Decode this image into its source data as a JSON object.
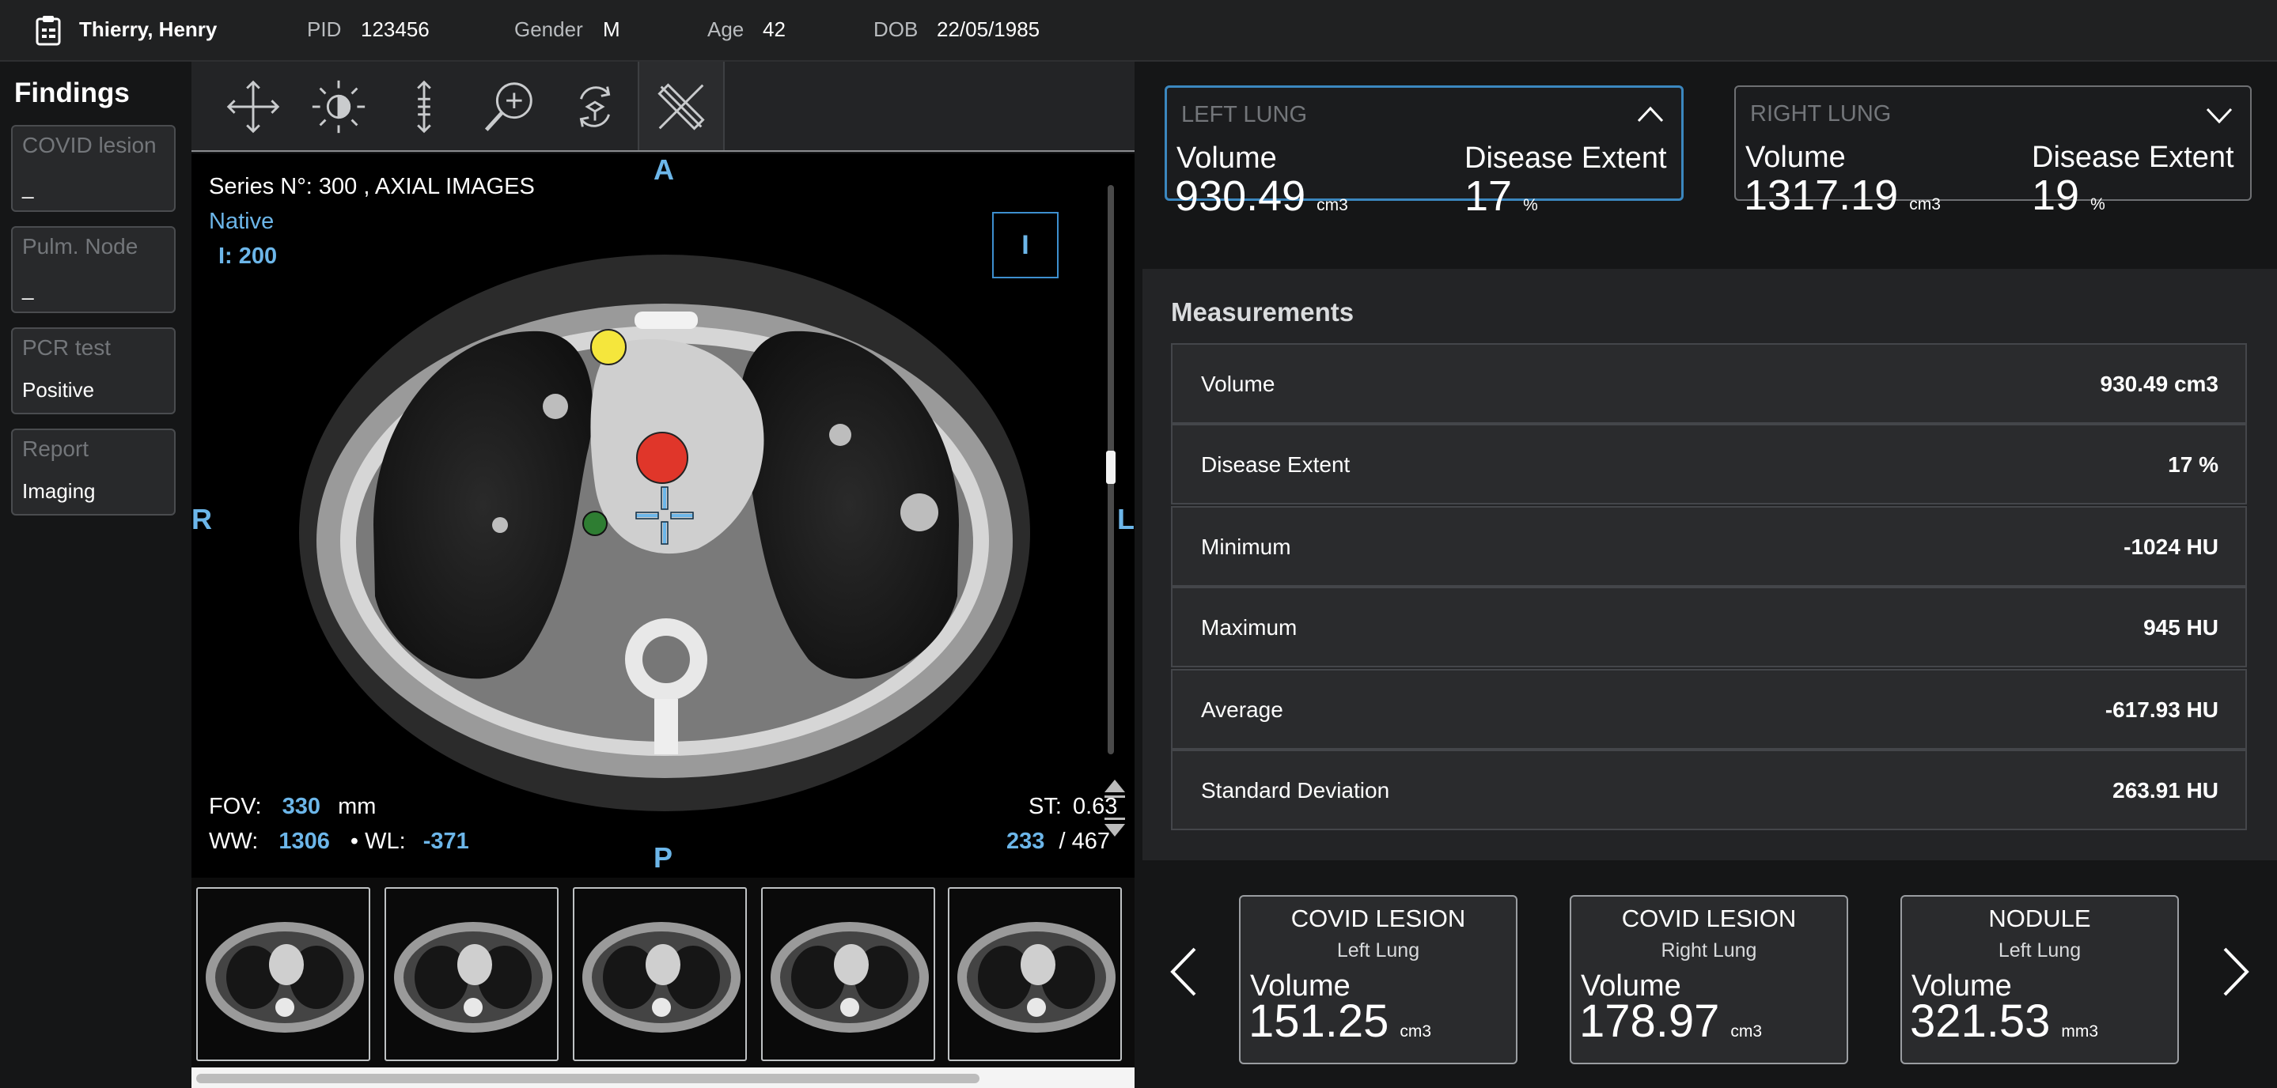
{
  "patient": {
    "name": "Thierry, Henry",
    "pid_label": "PID",
    "pid": "123456",
    "gender_label": "Gender",
    "gender": "M",
    "age_label": "Age",
    "age": "42",
    "dob_label": "DOB",
    "dob": "22/05/1985"
  },
  "findings": {
    "title": "Findings",
    "items": [
      {
        "label": "COVID lesion",
        "value": "_"
      },
      {
        "label": "Pulm. Node",
        "value": "_"
      },
      {
        "label": "PCR test",
        "value": "Positive"
      },
      {
        "label": "Report",
        "value": "Imaging"
      }
    ]
  },
  "toolbar": {
    "tools": [
      "move-icon",
      "brightness-icon",
      "scroll-slices-icon",
      "zoom-icon",
      "rotate-3d-icon",
      "measure-ruler-icon"
    ]
  },
  "viewer": {
    "series": "Series N°: 300 , AXIAL IMAGES",
    "mode": "Native",
    "image_index": "I: 200",
    "orientation": {
      "top": "A",
      "bottom": "P",
      "left": "R",
      "right": "L",
      "badge": "I"
    },
    "fov_label": "FOV:",
    "fov": "330",
    "fov_unit": "mm",
    "ww_label": "WW:",
    "ww": "1306",
    "wl_label": "• WL:",
    "wl": "-371",
    "st_label": "ST:",
    "st": "0.63",
    "slice": "233",
    "slice_total": "/ 467",
    "markers": {
      "yellow": "#f5e63c",
      "red": "#e0362a",
      "green": "#2e7d32",
      "crosshair": "#6cb6e9"
    }
  },
  "lungs": {
    "left": {
      "title": "LEFT LUNG",
      "volume_label": "Volume",
      "volume": "930.49",
      "volume_unit": "cm3",
      "extent_label": "Disease Extent",
      "extent": "17",
      "extent_unit": "%"
    },
    "right": {
      "title": "RIGHT LUNG",
      "volume_label": "Volume",
      "volume": "1317.19",
      "volume_unit": "cm3",
      "extent_label": "Disease Extent",
      "extent": "19",
      "extent_unit": "%"
    }
  },
  "measurements": {
    "title": "Measurements",
    "rows": [
      {
        "label": "Volume",
        "value": "930.49 cm3"
      },
      {
        "label": "Disease Extent",
        "value": "17 %"
      },
      {
        "label": "Minimum",
        "value": "-1024 HU"
      },
      {
        "label": "Maximum",
        "value": "945 HU"
      },
      {
        "label": "Average",
        "value": "-617.93 HU"
      },
      {
        "label": "Standard Deviation",
        "value": "263.91 HU"
      }
    ]
  },
  "lesions": [
    {
      "title": "COVID LESION",
      "location": "Left Lung",
      "volume_label": "Volume",
      "volume": "151.25",
      "unit": "cm3"
    },
    {
      "title": "COVID LESION",
      "location": "Right Lung",
      "volume_label": "Volume",
      "volume": "178.97",
      "unit": "cm3"
    },
    {
      "title": "NODULE",
      "location": "Left Lung",
      "volume_label": "Volume",
      "volume": "321.53",
      "unit": "mm3"
    }
  ],
  "colors": {
    "accent": "#6cb6e9",
    "active_border": "#3b87bf",
    "panel": "#232426",
    "background": "#151617"
  }
}
